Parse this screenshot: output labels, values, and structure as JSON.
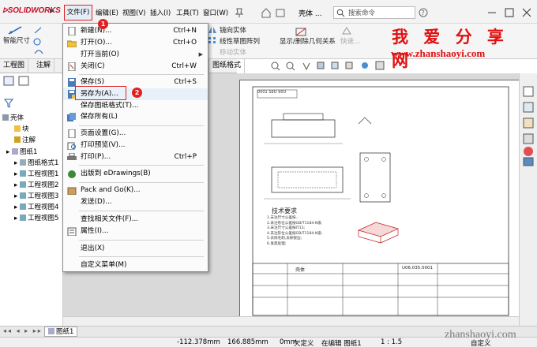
{
  "app": {
    "logo_text": "SOLIDWORKS"
  },
  "menubar": {
    "items": [
      "文件(F)",
      "编辑(E)",
      "视图(V)",
      "插入(I)",
      "工具(T)",
      "窗口(W)"
    ],
    "document_name": "壳体 ...",
    "search_placeholder": "搜索命令"
  },
  "toolbar": {
    "smart_dimension": "智能尺寸",
    "mirror_entities": "镜向实体",
    "linear_pattern": "线性草图阵列",
    "move_entities": "移动实体",
    "show_hide_relations": "显示/删除几何关系",
    "quick_snaps": "快速..."
  },
  "tabs": [
    "工程图",
    "注解",
    "图纸格式"
  ],
  "feature_tree": {
    "root": "壳体",
    "items": [
      "块",
      "注解",
      "图纸1",
      "图纸格式1",
      "工程视图1",
      "工程视图2",
      "工程视图3",
      "工程视图4",
      "工程视图5"
    ]
  },
  "file_menu": {
    "items": [
      {
        "label": "新建(N)...",
        "shortcut": "Ctrl+N",
        "icon": "new-doc-icon"
      },
      {
        "label": "打开(O)...",
        "shortcut": "Ctrl+O",
        "icon": "open-folder-icon"
      },
      {
        "label": "打开当前(O)",
        "shortcut": "",
        "icon": "",
        "submenu": true
      },
      {
        "label": "关闭(C)",
        "shortcut": "Ctrl+W",
        "icon": "close-doc-icon"
      },
      {
        "label": "保存(S)",
        "shortcut": "Ctrl+S",
        "icon": "save-icon"
      },
      {
        "label": "另存为(A)...",
        "shortcut": "",
        "icon": "save-as-icon"
      },
      {
        "label": "保存图纸格式(T)...",
        "shortcut": "",
        "icon": ""
      },
      {
        "label": "保存所有(L)",
        "shortcut": "",
        "icon": "save-all-icon"
      },
      {
        "label": "页面设置(G)...",
        "shortcut": "",
        "icon": "page-setup-icon"
      },
      {
        "label": "打印预览(V)...",
        "shortcut": "",
        "icon": "print-preview-icon"
      },
      {
        "label": "打印(P)...",
        "shortcut": "Ctrl+P",
        "icon": "print-icon"
      },
      {
        "label": "出版到 eDrawings(B)",
        "shortcut": "",
        "icon": "edrawings-icon"
      },
      {
        "label": "Pack and Go(K)...",
        "shortcut": "",
        "icon": "pack-and-go-icon"
      },
      {
        "label": "发送(D)...",
        "shortcut": "",
        "icon": ""
      },
      {
        "label": "查找相关文件(F)...",
        "shortcut": "",
        "icon": ""
      },
      {
        "label": "属性(I)...",
        "shortcut": "",
        "icon": "properties-icon"
      },
      {
        "label": "退出(X)",
        "shortcut": "",
        "icon": ""
      },
      {
        "label": "自定义菜单(M)",
        "shortcut": "",
        "icon": ""
      }
    ]
  },
  "annotations": {
    "badge1": "1",
    "badge2": "2"
  },
  "watermark": {
    "cn": "我 爱 分 享 网",
    "url": "www.zhanshaoyi.com",
    "url_bottom": "zhanshaoyi.com"
  },
  "drawing": {
    "tech_req_title": "技术要求",
    "tech_req_lines": [
      "1.未注尺寸公差按...",
      "2.未注形位公差按GB/T1184-K级;",
      "3.未注尺寸公差按IT13;",
      "4.未注形位公差按GB/T1184-K级;",
      "5.去除毛刺,去除锐边;",
      "6.发黑处理;"
    ],
    "title_block_part": "壳体",
    "drawing_no": "U06.035.0001",
    "top_label": "0001 SEO 90U"
  },
  "sheet_tab": "图纸1",
  "status": {
    "x": "-112.378mm",
    "y": "166.885mm",
    "z": "0mm",
    "state": "欠定义",
    "editing": "在编辑 图纸1",
    "scale": "1 : 1.5",
    "custom": "自定义"
  },
  "colors": {
    "accent_red": "#e02020",
    "watermark_red": "#e01010"
  }
}
